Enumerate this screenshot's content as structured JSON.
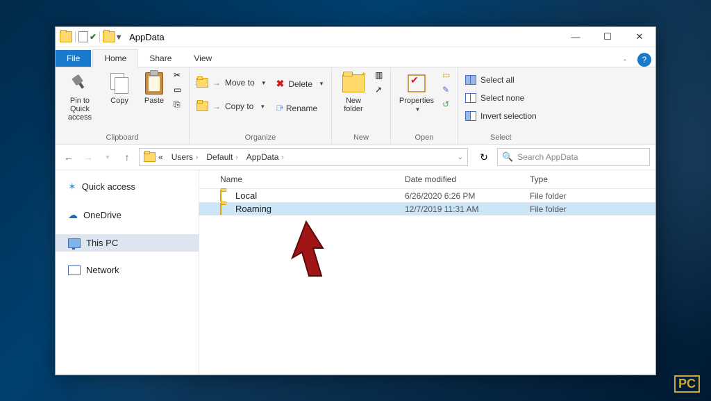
{
  "window": {
    "title": "AppData",
    "tabs": {
      "file": "File",
      "home": "Home",
      "share": "Share",
      "view": "View"
    }
  },
  "ribbon": {
    "clipboard": {
      "group": "Clipboard",
      "pin": "Pin to Quick\naccess",
      "copy": "Copy",
      "paste": "Paste"
    },
    "organize": {
      "group": "Organize",
      "move": "Move to",
      "copy": "Copy to",
      "del": "Delete",
      "rename": "Rename"
    },
    "new": {
      "group": "New",
      "folder": "New\nfolder"
    },
    "open": {
      "group": "Open",
      "props": "Properties"
    },
    "select": {
      "group": "Select",
      "all": "Select all",
      "none": "Select none",
      "inv": "Invert selection"
    }
  },
  "breadcrumbs": {
    "prefix": "«",
    "items": [
      "Users",
      "Default",
      "AppData"
    ]
  },
  "search": {
    "placeholder": "Search AppData"
  },
  "sidebar": {
    "quick": "Quick access",
    "onedrive": "OneDrive",
    "thispc": "This PC",
    "network": "Network"
  },
  "columns": {
    "name": "Name",
    "date": "Date modified",
    "type": "Type"
  },
  "rows": [
    {
      "name": "Local",
      "date": "6/26/2020 6:26 PM",
      "type": "File folder",
      "sel": false
    },
    {
      "name": "Roaming",
      "date": "12/7/2019 11:31 AM",
      "type": "File folder",
      "sel": true
    }
  ],
  "watermark": {
    "a": "",
    "b": "PC",
    "c": ""
  }
}
